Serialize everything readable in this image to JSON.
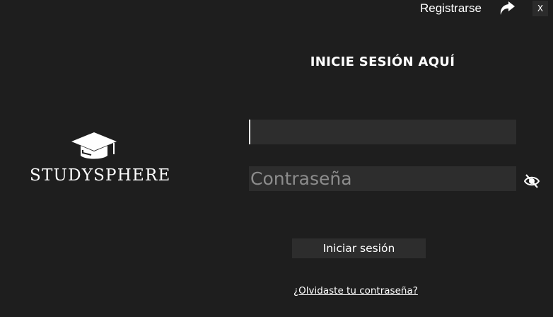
{
  "top_bar": {
    "register_label": "Registrarse",
    "register_icon": "share-arrow-icon",
    "close_label": "X"
  },
  "logo": {
    "icon": "graduation-cap-icon",
    "text": "STUDYSPHERE"
  },
  "login": {
    "heading": "INICIE SESIÓN AQUÍ",
    "username_value": "",
    "password_placeholder": "Contraseña",
    "password_toggle_icon": "eye-hidden-icon",
    "submit_label": "Iniciar sesión",
    "forgot_label": "¿Olvidaste tu contraseña?"
  },
  "colors": {
    "background": "#1e1e1e",
    "field": "#2d2d2d",
    "text": "#ffffff",
    "placeholder": "#8c8c8c"
  }
}
